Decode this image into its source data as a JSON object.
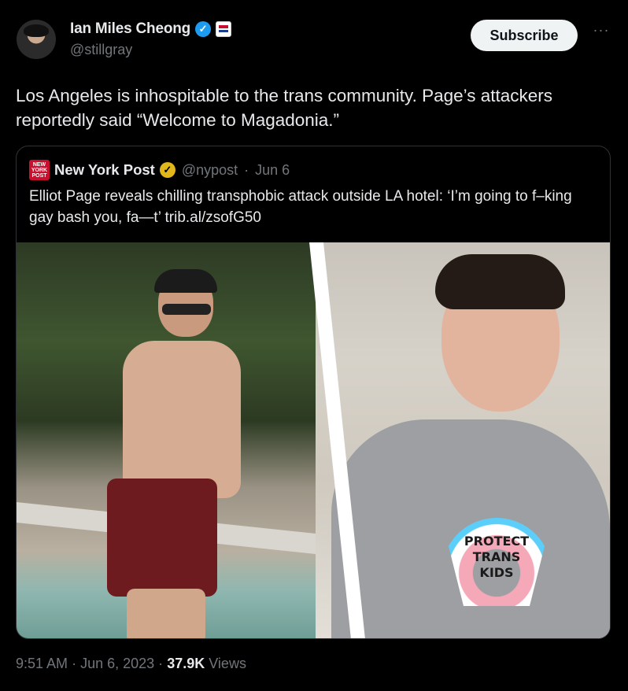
{
  "author": {
    "name": "Ian Miles Cheong",
    "handle": "@stillgray",
    "verified_icon": "verified-badge-icon",
    "affiliation_icon": "affiliate-flag-icon"
  },
  "actions": {
    "subscribe_label": "Subscribe",
    "more_label": "···"
  },
  "tweet": {
    "text": "Los Angeles is inhospitable to the trans community. Page’s attackers reportedly said “Welcome to Magadonia.”"
  },
  "quote": {
    "source_name": "New York Post",
    "source_handle": "@nypost",
    "separator": "·",
    "date": "Jun 6",
    "logo_text": "NEW YORK POST",
    "text": "Elliot Page reveals chilling transphobic attack outside LA hotel: ‘I’m going to f–king gay bash you, fa—t’ trib.al/zsofG50",
    "shirt_lines": [
      "PROTECT",
      "TRANS",
      "KIDS"
    ]
  },
  "footer": {
    "time": "9:51 AM",
    "dot1": "·",
    "date": "Jun 6, 2023",
    "dot2": "·",
    "views_count": "37.9K",
    "views_label": "Views"
  },
  "colors": {
    "background": "#000000",
    "text": "#e7e9ea",
    "muted": "#71767b",
    "verified_blue": "#1d9bf0",
    "gold_badge": "#e2b719",
    "subscribe_bg": "#eff3f4"
  }
}
